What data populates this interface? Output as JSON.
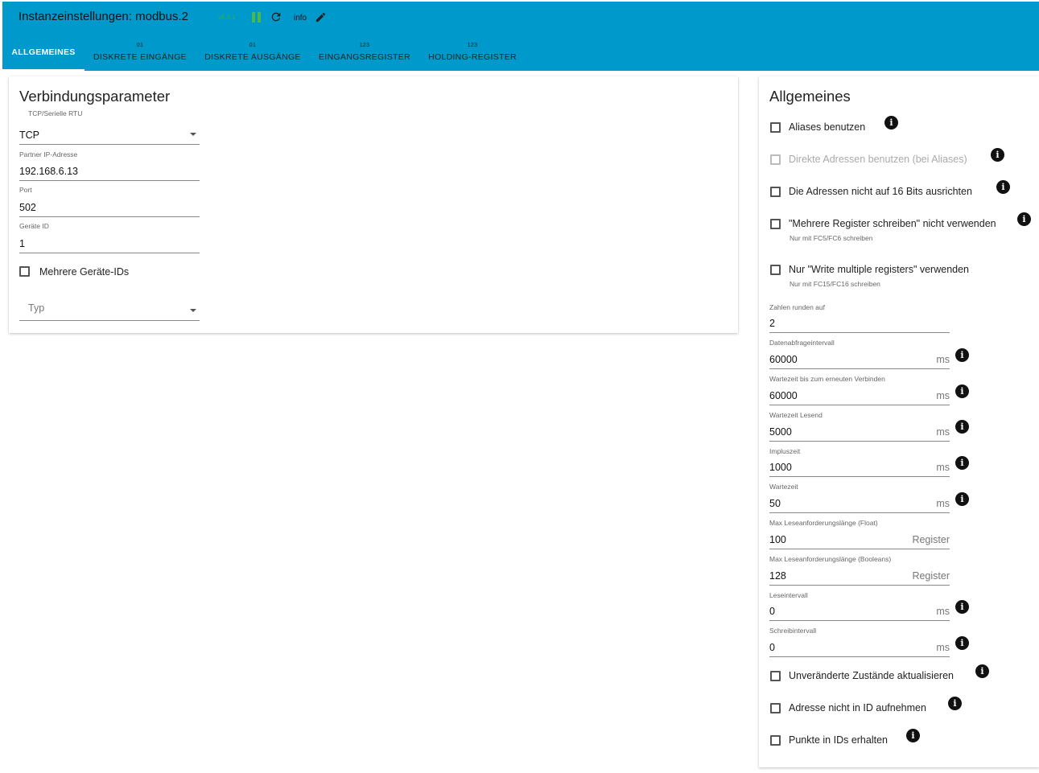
{
  "header": {
    "title": "Instanzeinstellungen: modbus.2",
    "version": "v6.0.1",
    "info_label": "info"
  },
  "tabs": [
    {
      "top": "",
      "label": "ALLGEMEINES"
    },
    {
      "top": "01",
      "label": "DISKRETE EINGÄNGE"
    },
    {
      "top": "01",
      "label": "DISKRETE AUSGÄNGE"
    },
    {
      "top": "123",
      "label": "EINGANGSREGISTER"
    },
    {
      "top": "123",
      "label": "HOLDING-REGISTER"
    }
  ],
  "connection": {
    "title": "Verbindungsparameter",
    "type_label": "TCP/Serielle RTU",
    "type_value": "TCP",
    "ip_label": "Partner IP-Adresse",
    "ip_value": "192.168.6.13",
    "port_label": "Port",
    "port_value": "502",
    "device_label": "Geräte ID",
    "device_value": "1",
    "multi_ids_label": "Mehrere Geräte-IDs",
    "typ_placeholder": "Typ"
  },
  "general": {
    "title": "Allgemeines",
    "checkboxes": [
      {
        "label": "Aliases benutzen",
        "hint": ""
      },
      {
        "label": "Direkte Adressen benutzen (bei Aliases)",
        "hint": ""
      },
      {
        "label": "Die Adressen nicht auf 16 Bits ausrichten",
        "hint": ""
      },
      {
        "label": "\"Mehrere Register schreiben\" nicht verwenden",
        "hint": "Nur mit FC5/FC6 schreiben"
      },
      {
        "label": "Nur \"Write multiple registers\" verwenden",
        "hint": "Nur mit FC15/FC16 schreiben"
      }
    ],
    "fields": [
      {
        "label": "Zahlen runden auf",
        "value": "2",
        "unit": ""
      },
      {
        "label": "Datenabfrageintervall",
        "value": "60000",
        "unit": "ms"
      },
      {
        "label": "Wartezeit bis zum erneuten Verbinden",
        "value": "60000",
        "unit": "ms"
      },
      {
        "label": "Wartezeit Lesend",
        "value": "5000",
        "unit": "ms"
      },
      {
        "label": "Impluszeit",
        "value": "1000",
        "unit": "ms"
      },
      {
        "label": "Wartezeit",
        "value": "50",
        "unit": "ms"
      },
      {
        "label": "Max Leseanforderungslänge (Float)",
        "value": "100",
        "unit": "Register"
      },
      {
        "label": "Max Leseanforderungslänge (Booleans)",
        "value": "128",
        "unit": "Register"
      },
      {
        "label": "Leseintervall",
        "value": "0",
        "unit": "ms"
      },
      {
        "label": "Schreibintervall",
        "value": "0",
        "unit": "ms"
      }
    ],
    "bottom_checkboxes": [
      {
        "label": "Unveränderte Zustände aktualisieren"
      },
      {
        "label": "Adresse nicht in ID aufnehmen"
      },
      {
        "label": "Punkte in IDs erhalten"
      }
    ]
  }
}
